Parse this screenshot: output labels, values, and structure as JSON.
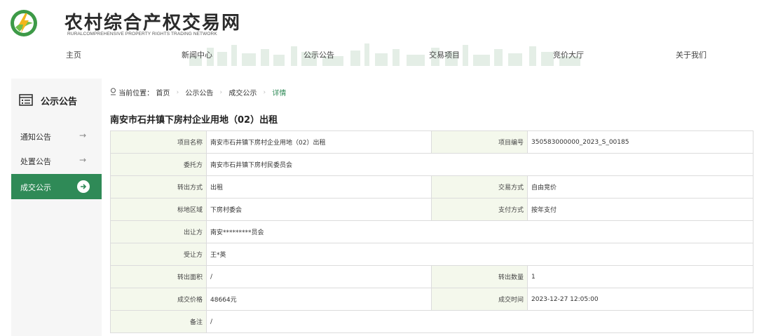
{
  "site": {
    "title": "农村综合产权交易网",
    "subtitle": "RURALCOMPREHENSIVE PROPERTY RIGHTS TRADING NETWORK"
  },
  "nav": {
    "items": [
      "主页",
      "新闻中心",
      "公示公告",
      "交易项目",
      "竞价大厅",
      "关于我们"
    ]
  },
  "sidebar": {
    "heading": "公示公告",
    "items": [
      {
        "label": "通知公告",
        "active": false
      },
      {
        "label": "处置公告",
        "active": false
      },
      {
        "label": "成交公示",
        "active": true
      }
    ]
  },
  "breadcrumb": {
    "prefix": "当前位置：",
    "items": [
      "首页",
      "公示公告",
      "成交公示"
    ],
    "current": "详情"
  },
  "page_title": "南安市石井镇下房村企业用地（02）出租",
  "detail": {
    "rows": [
      {
        "k1": "项目名称",
        "v1": "南安市石井镇下房村企业用地（02）出租",
        "k2": "项目编号",
        "v2": "350583000000_2023_S_00185"
      },
      {
        "k1": "委托方",
        "v1": "南安市石井镇下房村民委员会"
      },
      {
        "k1": "转出方式",
        "v1": "出租",
        "k2": "交易方式",
        "v2": "自由竞价"
      },
      {
        "k1": "标地区域",
        "v1": "下房村委会",
        "k2": "支付方式",
        "v2": "按年支付"
      },
      {
        "k1": "出让方",
        "v1": "南安*********员会"
      },
      {
        "k1": "受让方",
        "v1": "王*英"
      },
      {
        "k1": "转出面积",
        "v1": "/",
        "k2": "转出数量",
        "v2": "1"
      },
      {
        "k1": "成交价格",
        "v1": "48664元",
        "k2": "成交时间",
        "v2": "2023-12-27 12:05:00"
      },
      {
        "k1": "备注",
        "v1": "/"
      }
    ]
  },
  "colors": {
    "accent": "#2f8a57",
    "label_bg": "#f4f8ec",
    "sidebar_bg": "#f6f6f6"
  }
}
